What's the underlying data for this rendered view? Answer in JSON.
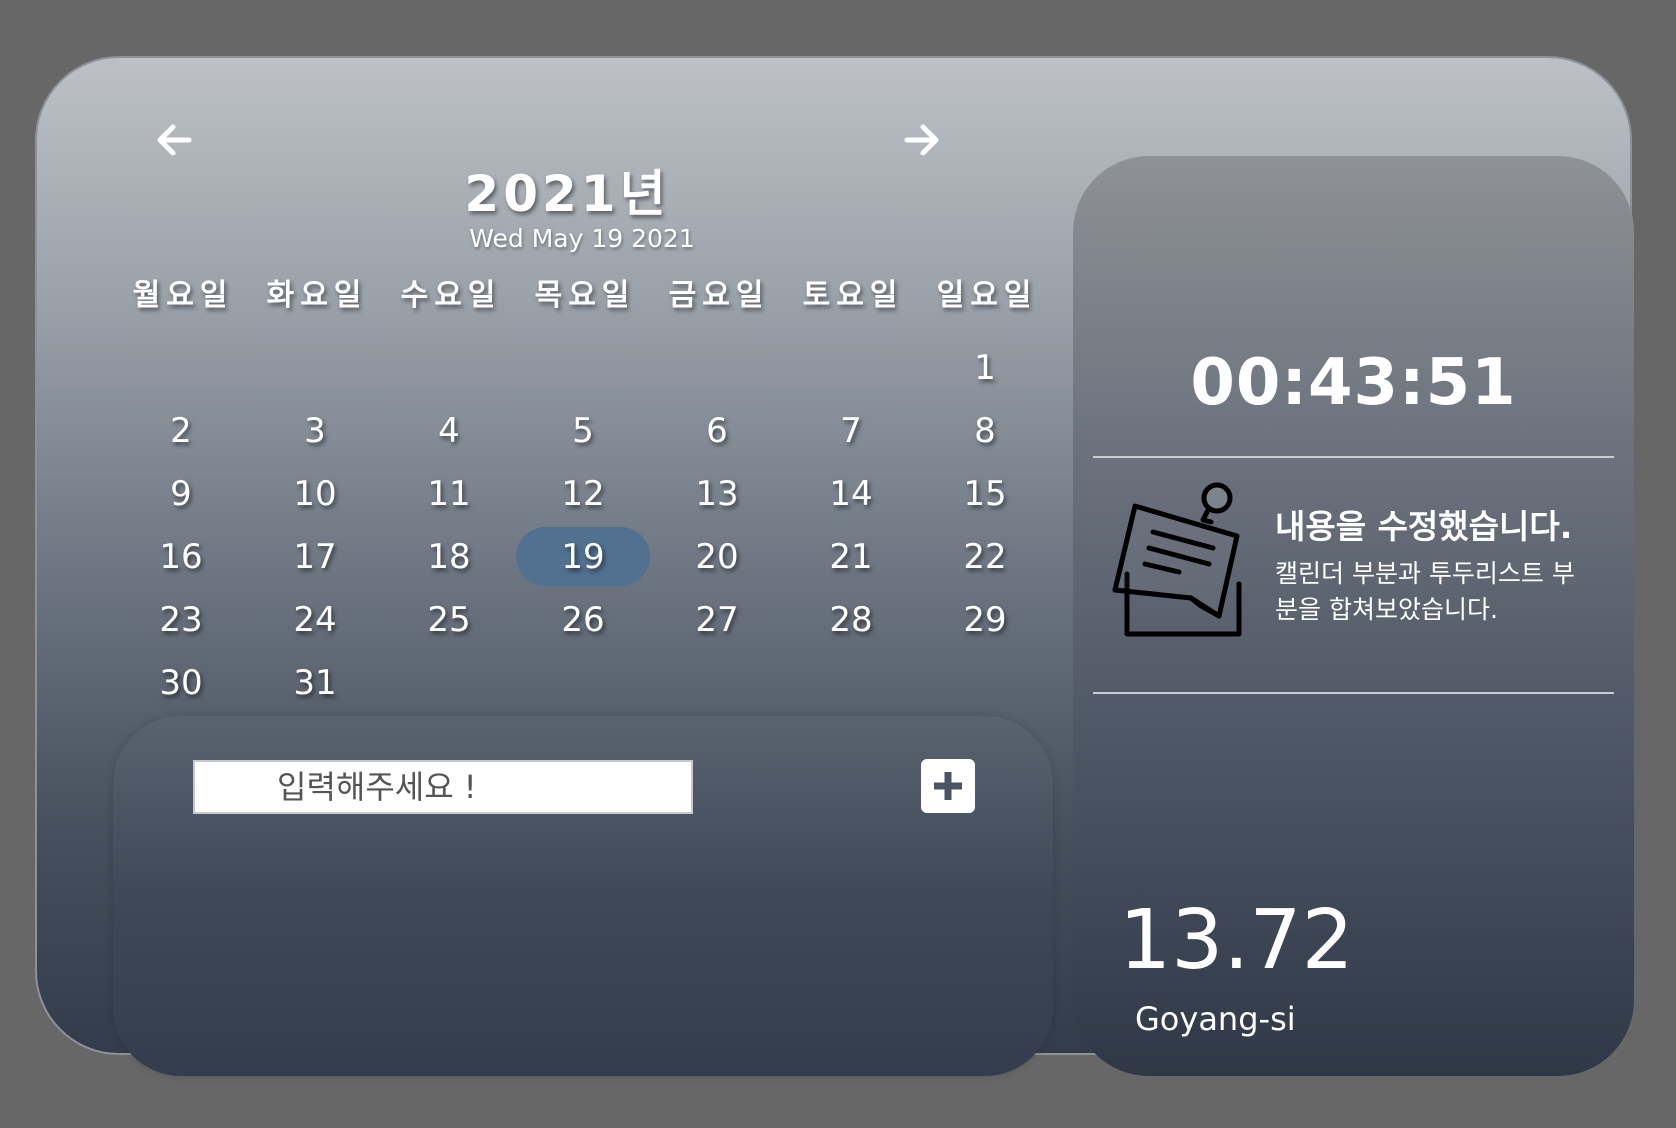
{
  "calendar": {
    "year": "2021년",
    "current_date": "Wed May 19 2021",
    "weekdays": [
      "월요일",
      "화요일",
      "수요일",
      "목요일",
      "금요일",
      "토요일",
      "일요일"
    ],
    "leading_blanks": 6,
    "days": [
      "1",
      "2",
      "3",
      "4",
      "5",
      "6",
      "7",
      "8",
      "9",
      "10",
      "11",
      "12",
      "13",
      "14",
      "15",
      "16",
      "17",
      "18",
      "19",
      "20",
      "21",
      "22",
      "23",
      "24",
      "25",
      "26",
      "27",
      "28",
      "29",
      "30",
      "31"
    ],
    "selected_day": "19",
    "prev_icon": "arrow-left-icon",
    "next_icon": "arrow-right-icon",
    "selected_color": "#52708f"
  },
  "todo": {
    "placeholder": "입력해주세요 !",
    "value": "",
    "add_icon": "plus-icon"
  },
  "side": {
    "clock": "00:43:51",
    "note": {
      "icon": "sticky-note-icon",
      "title": "내용을 수정했습니다.",
      "body": "캘린더 부분과 투두리스트 부분을 합쳐보았습니다."
    },
    "weather": {
      "temperature": "13.72",
      "city": "Goyang-si"
    }
  }
}
